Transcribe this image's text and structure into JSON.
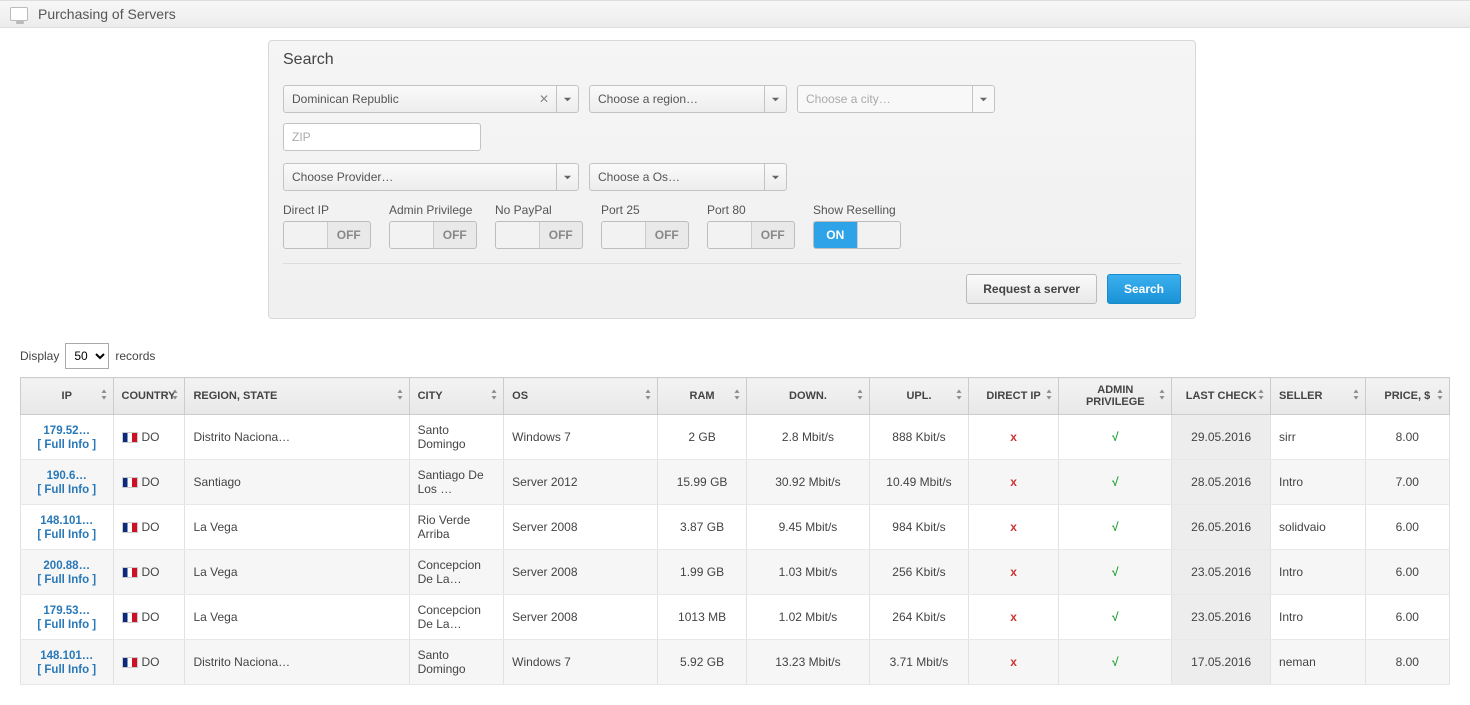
{
  "header": {
    "title": "Purchasing of Servers"
  },
  "search": {
    "panel_title": "Search",
    "country": "Dominican Republic",
    "region_placeholder": "Choose a region…",
    "city_placeholder": "Choose a city…",
    "zip_placeholder": "ZIP",
    "provider_placeholder": "Choose Provider…",
    "os_placeholder": "Choose a Os…",
    "toggles": [
      {
        "label": "Direct IP",
        "state": "OFF"
      },
      {
        "label": "Admin Privilege",
        "state": "OFF"
      },
      {
        "label": "No PayPal",
        "state": "OFF"
      },
      {
        "label": "Port 25",
        "state": "OFF"
      },
      {
        "label": "Port 80",
        "state": "OFF"
      },
      {
        "label": "Show Reselling",
        "state": "ON"
      }
    ],
    "request_button": "Request a server",
    "search_button": "Search"
  },
  "display": {
    "prefix": "Display",
    "value": "50",
    "suffix": "records"
  },
  "columns": [
    "IP",
    "Country",
    "Region, State",
    "City",
    "OS",
    "RAM",
    "Down.",
    "Upl.",
    "Direct IP",
    "Admin Privilege",
    "Last Check",
    "Seller",
    "Price, $"
  ],
  "full_info_label": "[ Full Info ]",
  "rows": [
    {
      "ip": "179.52…",
      "country": "DO",
      "region": "Distrito Naciona…",
      "city": "Santo Domingo",
      "os": "Windows 7",
      "ram": "2 GB",
      "down": "2.8 Mbit/s",
      "upl": "888 Kbit/s",
      "direct_ip": "x",
      "admin": "√",
      "last_check": "29.05.2016",
      "seller": "sirr",
      "price": "8.00"
    },
    {
      "ip": "190.6…",
      "country": "DO",
      "region": "Santiago",
      "city": "Santiago De Los …",
      "os": "Server 2012",
      "ram": "15.99 GB",
      "down": "30.92 Mbit/s",
      "upl": "10.49 Mbit/s",
      "direct_ip": "x",
      "admin": "√",
      "last_check": "28.05.2016",
      "seller": "Intro",
      "price": "7.00"
    },
    {
      "ip": "148.101…",
      "country": "DO",
      "region": "La Vega",
      "city": "Rio Verde Arriba",
      "os": "Server 2008",
      "ram": "3.87 GB",
      "down": "9.45 Mbit/s",
      "upl": "984 Kbit/s",
      "direct_ip": "x",
      "admin": "√",
      "last_check": "26.05.2016",
      "seller": "solidvaio",
      "price": "6.00"
    },
    {
      "ip": "200.88…",
      "country": "DO",
      "region": "La Vega",
      "city": "Concepcion De La…",
      "os": "Server 2008",
      "ram": "1.99 GB",
      "down": "1.03 Mbit/s",
      "upl": "256 Kbit/s",
      "direct_ip": "x",
      "admin": "√",
      "last_check": "23.05.2016",
      "seller": "Intro",
      "price": "6.00"
    },
    {
      "ip": "179.53…",
      "country": "DO",
      "region": "La Vega",
      "city": "Concepcion De La…",
      "os": "Server 2008",
      "ram": "1013 MB",
      "down": "1.02 Mbit/s",
      "upl": "264 Kbit/s",
      "direct_ip": "x",
      "admin": "√",
      "last_check": "23.05.2016",
      "seller": "Intro",
      "price": "6.00"
    },
    {
      "ip": "148.101…",
      "country": "DO",
      "region": "Distrito Naciona…",
      "city": "Santo Domingo",
      "os": "Windows 7",
      "ram": "5.92 GB",
      "down": "13.23 Mbit/s",
      "upl": "3.71 Mbit/s",
      "direct_ip": "x",
      "admin": "√",
      "last_check": "17.05.2016",
      "seller": "neman",
      "price": "8.00"
    }
  ]
}
